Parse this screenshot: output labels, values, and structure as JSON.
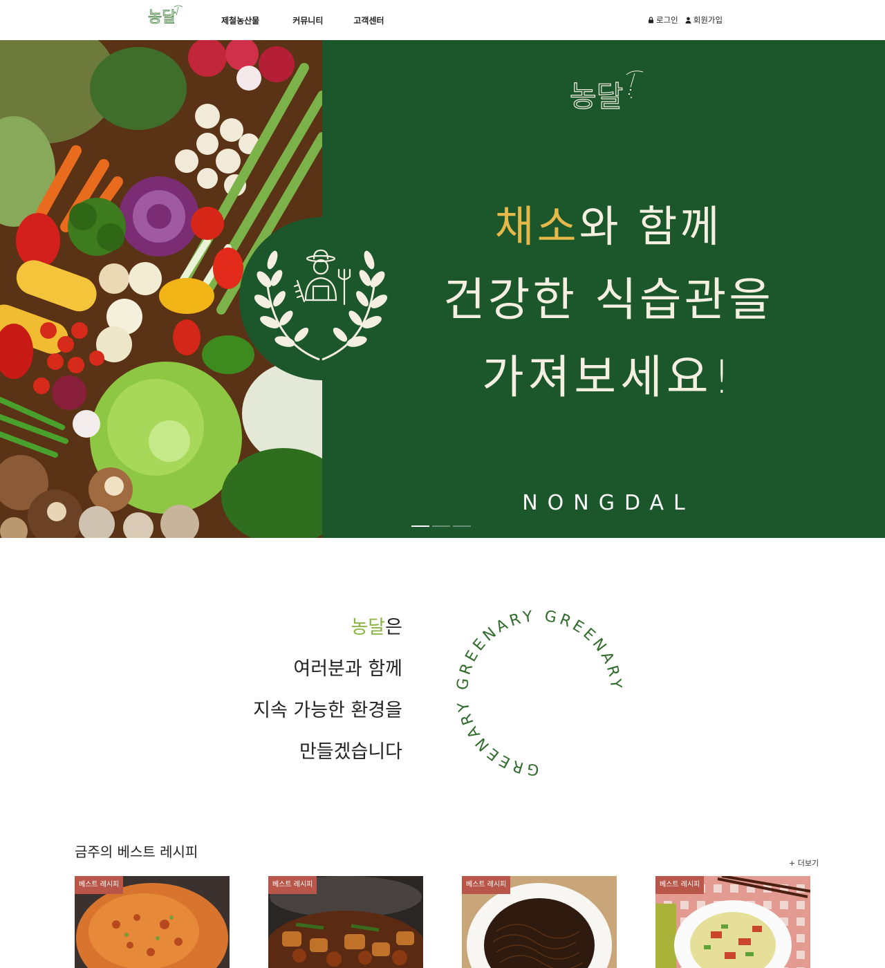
{
  "header": {
    "logo_text": "농달",
    "nav": [
      {
        "label": "제철농산물"
      },
      {
        "label": "커뮤니티"
      },
      {
        "label": "고객센터"
      }
    ],
    "auth": {
      "login": "로그인",
      "signup": "회원가입"
    }
  },
  "hero": {
    "logo_text": "농달",
    "line1_highlight": "채소",
    "line1_rest": "와 함께",
    "line2": "건강한 식습관을",
    "line3": "가져보세요!",
    "brand_en": "NONGDAL",
    "slides_total": 3,
    "slide_active": 1,
    "colors": {
      "background": "#1b572b",
      "highlight": "#e5b84a",
      "text": "#f5efe2"
    }
  },
  "intro": {
    "brand": "농달",
    "line1_rest": "은",
    "line2": "여러분과 함께",
    "line3": "지속 가능한 환경을",
    "line4": "만들겠습니다",
    "ring_text": "GREENARY GREENARY GREENARY",
    "colors": {
      "brand": "#8ab544",
      "ring": "#2f6b2a"
    }
  },
  "recipes": {
    "title": "금주의 베스트 레시피",
    "more": "+ 더보기",
    "cards": [
      {
        "badge": "베스트 레시피",
        "image": "kimchi-pancake"
      },
      {
        "badge": "베스트 레시피",
        "image": "braised-dish"
      },
      {
        "badge": "베스트 레시피",
        "image": "japchae-noodles"
      },
      {
        "badge": "베스트 레시피",
        "image": "cabbage-stir-fry"
      }
    ]
  }
}
